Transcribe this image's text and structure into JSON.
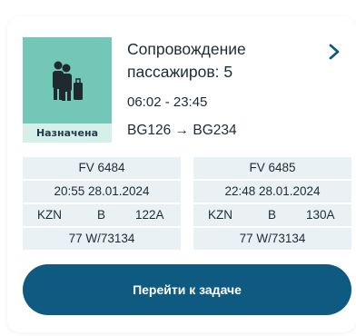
{
  "task": {
    "title": "Сопровождение пассажиров: 5",
    "time": "06:02 - 23:45",
    "route": "BG126 → BG234",
    "status": "Назначена",
    "status_icon": "passengers-icon"
  },
  "flights": [
    {
      "number": "FV 6484",
      "datetime": "20:55 28.01.2024",
      "airport": "KZN",
      "terminal": "B",
      "gate": "122A",
      "aircraft": "77 W/73134"
    },
    {
      "number": "FV 6485",
      "datetime": "22:48 28.01.2024",
      "airport": "KZN",
      "terminal": "B",
      "gate": "130A",
      "aircraft": "77 W/73134"
    }
  ],
  "action": {
    "label": "Перейти к задаче"
  },
  "colors": {
    "accent": "#0f5a80",
    "status_tile": "#73c7b6",
    "status_bg": "#d7efe9",
    "row_bg": "#eaf1f5"
  }
}
